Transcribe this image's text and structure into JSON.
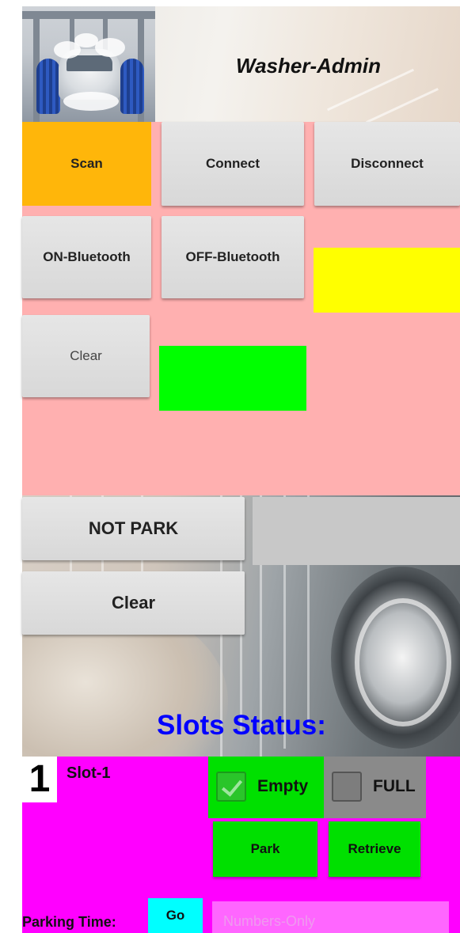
{
  "header": {
    "title": "Washer-Admin"
  },
  "controls": {
    "scan_label": "Scan",
    "connect_label": "Connect",
    "disconnect_label": "Disconnect",
    "on_bluetooth_label": "ON-Bluetooth",
    "off_bluetooth_label": "OFF-Bluetooth",
    "clear_label": "Clear"
  },
  "parking": {
    "status_label": "NOT PARK",
    "clear_label": "Clear"
  },
  "slots": {
    "heading": "Slots Status:",
    "slot1": {
      "number": "1",
      "name": "Slot-1",
      "empty_label": "Empty",
      "empty_checked": true,
      "full_label": "FULL",
      "full_checked": false,
      "park_label": "Park",
      "retrieve_label": "Retrieve"
    }
  },
  "parking_time": {
    "label": "Parking Time:",
    "go_label": "Go",
    "placeholder": "Numbers-Only"
  },
  "colors": {
    "controls_background": "#ffb0b0",
    "scan_button": "#ffb60a",
    "status_yellow": "#ffff00",
    "status_green": "#00ff00",
    "slot_panel": "#ff00ff",
    "slots_heading": "#0000ff",
    "go_button": "#00ffff"
  }
}
